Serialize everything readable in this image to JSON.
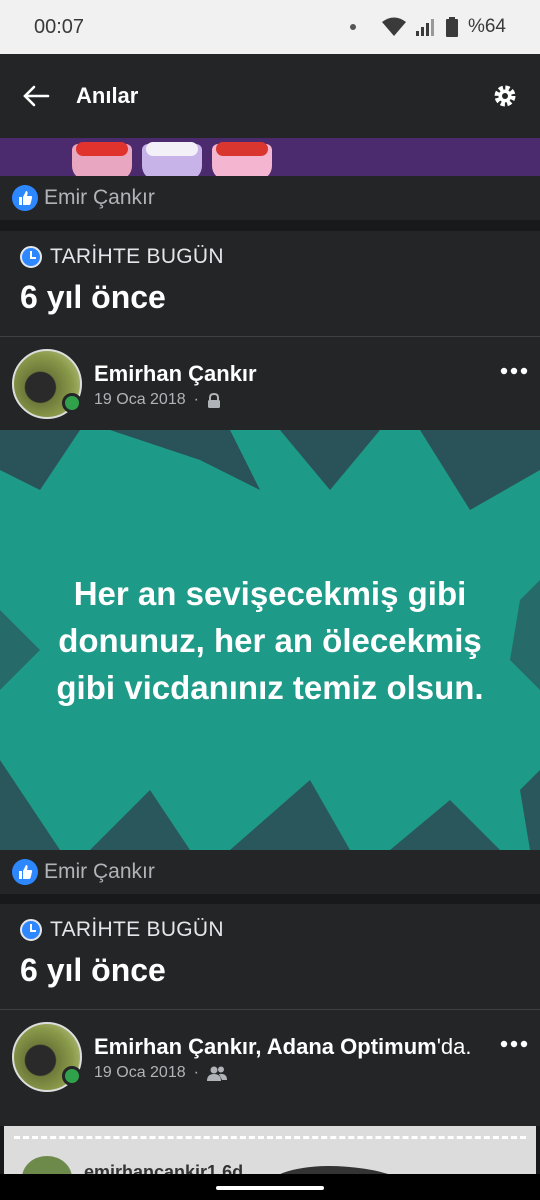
{
  "status_bar": {
    "time": "00:07",
    "battery": "%64"
  },
  "app_bar": {
    "title": "Anılar"
  },
  "reactions": [
    {
      "name": "Emir Çankır"
    },
    {
      "name": "Emir Çankır"
    }
  ],
  "memories": [
    {
      "kicker": "TARİHTE BUGÜN",
      "ago": "6 yıl önce"
    },
    {
      "kicker": "TARİHTE BUGÜN",
      "ago": "6 yıl önce"
    }
  ],
  "posts": [
    {
      "author": "Emirhan Çankır",
      "date": "19 Oca 2018",
      "privacy_icon": "lock-icon",
      "text": "Her an sevişecekmiş gibi donunuz, her an ölecekmiş gibi vicdanınız temiz olsun."
    },
    {
      "author": "Emirhan Çankır, Adana Optimum",
      "location_suffix": "'da.",
      "date": "19 Oca 2018",
      "privacy_icon": "friends-icon",
      "preview_username": "emirhancankir1 6d"
    }
  ],
  "colors": {
    "accent": "#2d88ff",
    "online": "#31a24c",
    "card": "#242526",
    "quote_bg": "#1e9a88"
  }
}
